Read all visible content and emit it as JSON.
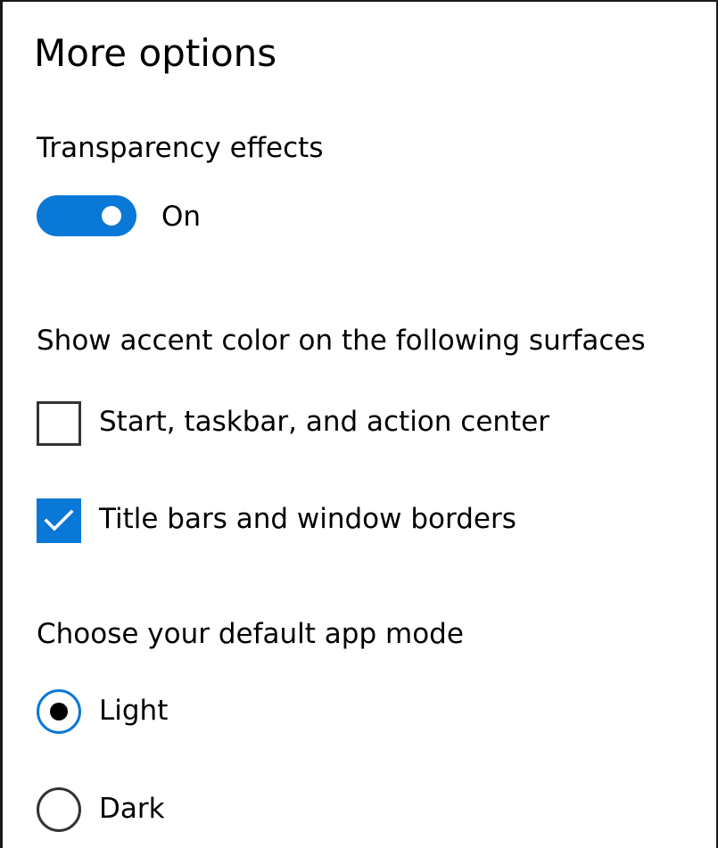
{
  "panel": {
    "title": "More options"
  },
  "transparency": {
    "label": "Transparency effects",
    "state_label": "On",
    "enabled": true
  },
  "accent_surfaces": {
    "label": "Show accent color on the following surfaces",
    "options": [
      {
        "label": "Start, taskbar, and action center",
        "checked": false
      },
      {
        "label": "Title bars and window borders",
        "checked": true
      }
    ]
  },
  "app_mode": {
    "label": "Choose your default app mode",
    "options": [
      {
        "label": "Light",
        "selected": true
      },
      {
        "label": "Dark",
        "selected": false
      }
    ]
  },
  "colors": {
    "accent": "#0a78d7",
    "text": "#000000",
    "border": "#333333"
  }
}
